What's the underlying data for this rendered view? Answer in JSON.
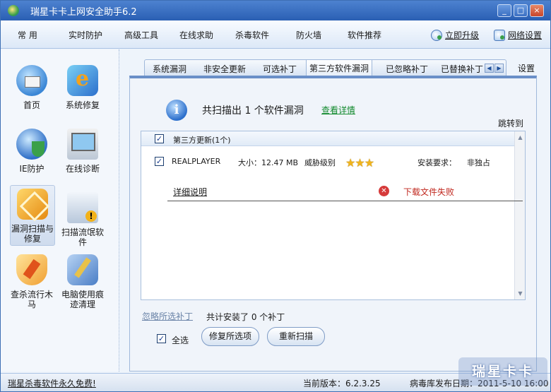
{
  "window": {
    "title": "瑞星卡卡上网安全助手6.2",
    "minimize_icon": "minimize-icon",
    "maximize_icon": "maximize-icon",
    "close_icon": "close-icon"
  },
  "menu": {
    "items": [
      "常 用",
      "实时防护",
      "高级工具",
      "在线求助",
      "杀毒软件",
      "防火墙",
      "软件推荐"
    ],
    "upgrade_label": "立即升级",
    "settings_label": "网络设置"
  },
  "sidebar": {
    "items": [
      {
        "label": "首页",
        "icon": "home-icon"
      },
      {
        "label": "系统修复",
        "icon": "system-repair-icon"
      },
      {
        "label": "IE防护",
        "icon": "ie-shield-icon"
      },
      {
        "label": "在线诊断",
        "icon": "online-diagnosis-icon"
      },
      {
        "label": "漏洞扫描与修复",
        "icon": "vulnerability-scan-icon",
        "active": true
      },
      {
        "label": "扫描流氓软件",
        "icon": "rogue-software-scan-icon"
      },
      {
        "label": "查杀流行木马",
        "icon": "trojan-scan-icon"
      },
      {
        "label": "电脑使用痕迹清理",
        "icon": "trace-cleanup-icon"
      }
    ]
  },
  "tabs": {
    "items": [
      "系统漏洞",
      "非安全更新",
      "可选补丁",
      "第三方软件漏洞",
      "已忽略补丁",
      "已替换补丁"
    ],
    "active": "第三方软件漏洞",
    "settings_label": "设置"
  },
  "scan": {
    "summary": "共扫描出 1 个软件漏洞",
    "detail_link": "查看详情",
    "jump_to": "跳转到"
  },
  "list": {
    "group_label": "第三方更新(1个)",
    "group_checked": true,
    "item": {
      "name": "REALPLAYER",
      "size_label": "大小：12.47 MB",
      "threat_label": "威胁级别",
      "threat_stars": 3,
      "install_label": "安装要求：",
      "install_value": "非独占",
      "checked": true,
      "detail_link": "详细说明",
      "status": "下载文件失败",
      "status_color": "#c0271e"
    }
  },
  "footer": {
    "ignore_link": "忽略所选补丁",
    "install_count": "共计安装了 0 个补丁",
    "select_all_label": "全选",
    "select_all_checked": true,
    "fix_button": "修复所选项",
    "rescan_button": "重新扫描"
  },
  "statusbar": {
    "free_text": "瑞星杀毒软件永久免费!",
    "version": "当前版本：6.2.3.25",
    "virus_db": "病毒库发布日期：2011-5-10 16:00"
  },
  "watermark": "瑞星卡卡",
  "colors": {
    "title_bar": "#2a5fb3",
    "link_green": "#138a2e",
    "error_red": "#c0271e",
    "star_gold": "#f0b41c"
  }
}
